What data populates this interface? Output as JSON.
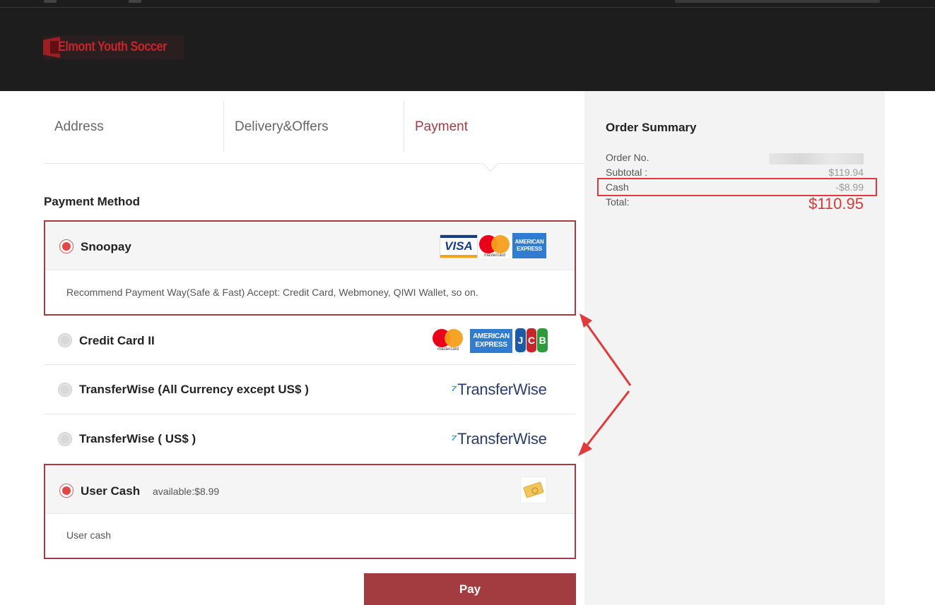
{
  "header": {
    "logo_text": "Elmont Youth Soccer"
  },
  "steps": [
    {
      "label": "Address",
      "active": false
    },
    {
      "label": "Delivery&Offers",
      "active": false
    },
    {
      "label": "Payment",
      "active": true
    }
  ],
  "payment": {
    "title": "Payment Method",
    "methods": [
      {
        "label": "Snoopay",
        "selected": true,
        "description": "Recommend Payment Way(Safe & Fast) Accept: Credit Card, Webmoney, QIWI Wallet, so on.",
        "logos": [
          "visa-icon",
          "mastercard-icon",
          "amex-icon"
        ],
        "logo_text": {
          "visa": "VISA",
          "mastercard": "mastercard",
          "amex_line1": "AMERICAN",
          "amex_line2": "EXPRESS"
        }
      },
      {
        "label": "Credit Card II",
        "selected": false,
        "logos": [
          "mastercard-icon",
          "amex-icon",
          "jcb-icon"
        ],
        "logo_text": {
          "mastercard": "mastercard",
          "amex_line1": "AMERICAN",
          "amex_line2": "EXPRESS",
          "jcb_j": "J",
          "jcb_c": "C",
          "jcb_b": "B"
        }
      },
      {
        "label": "TransferWise (All Currency except US$ )",
        "selected": false,
        "logos": [
          "transferwise-logo"
        ],
        "logo_text": {
          "mark": "⁷",
          "brand": "TransferWise"
        }
      },
      {
        "label": "TransferWise ( US$ )",
        "selected": false,
        "logos": [
          "transferwise-logo"
        ],
        "logo_text": {
          "mark": "⁷",
          "brand": "TransferWise"
        }
      },
      {
        "label": "User Cash",
        "selected": true,
        "available": "available:$8.99",
        "description": "User cash",
        "logos": [
          "cash-icon"
        ]
      }
    ],
    "pay_button": "Pay"
  },
  "order_summary": {
    "title": "Order Summary",
    "rows": [
      {
        "label": "Order No.",
        "value": ""
      },
      {
        "label": "Subtotal :",
        "value": "$119.94"
      },
      {
        "label": "Cash",
        "value": "-$8.99"
      },
      {
        "label": "Total:",
        "value": "$110.95"
      }
    ]
  },
  "colors": {
    "accent": "#a33c40",
    "header_bg": "#1d1d1d",
    "sidebar_bg": "#f3f3f3",
    "total_red": "#d63b3b",
    "annotation_red": "#e03a3a"
  }
}
